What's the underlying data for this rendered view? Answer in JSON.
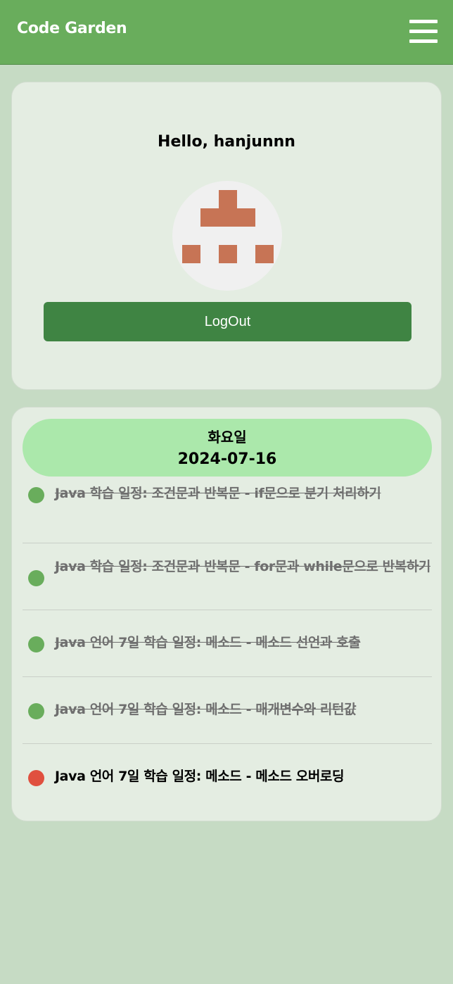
{
  "header": {
    "app_title": "Code Garden",
    "menu_icon": "hamburger-menu-icon"
  },
  "profile": {
    "greeting": "Hello, hanjunnn",
    "avatar_icon": "identicon-avatar",
    "logout_label": "LogOut"
  },
  "schedule": {
    "day": "화요일",
    "date": "2024-07-16",
    "tasks": [
      {
        "text": "Java 학습 일정: 조건문과 반복문 - if문으로 분기 처리하기",
        "status": "done",
        "status_color": "#69ad5c"
      },
      {
        "text": "Java 학습 일정: 조건문과 반복문 - for문과 while문으로 반복하기",
        "status": "done",
        "status_color": "#69ad5c"
      },
      {
        "text": "Java 언어 7일 학습 일정: 메소드 - 메소드 선언과 호출",
        "status": "done",
        "status_color": "#69ad5c"
      },
      {
        "text": "Java 언어 7일 학습 일정: 메소드 - 매개변수와 리턴값",
        "status": "done",
        "status_color": "#69ad5c"
      },
      {
        "text": "Java 언어 7일 학습 일정: 메소드 - 메소드 오버로딩",
        "status": "todo",
        "status_color": "#e0503f"
      }
    ]
  },
  "colors": {
    "header_bg": "#69ad5c",
    "page_bg": "#c6dbc4",
    "card_bg": "#e4ede2",
    "button_bg": "#3f8443",
    "date_pill_bg": "#abe8ab",
    "avatar_fg": "#c77455",
    "done_dot": "#69ad5c",
    "todo_dot": "#e0503f"
  }
}
